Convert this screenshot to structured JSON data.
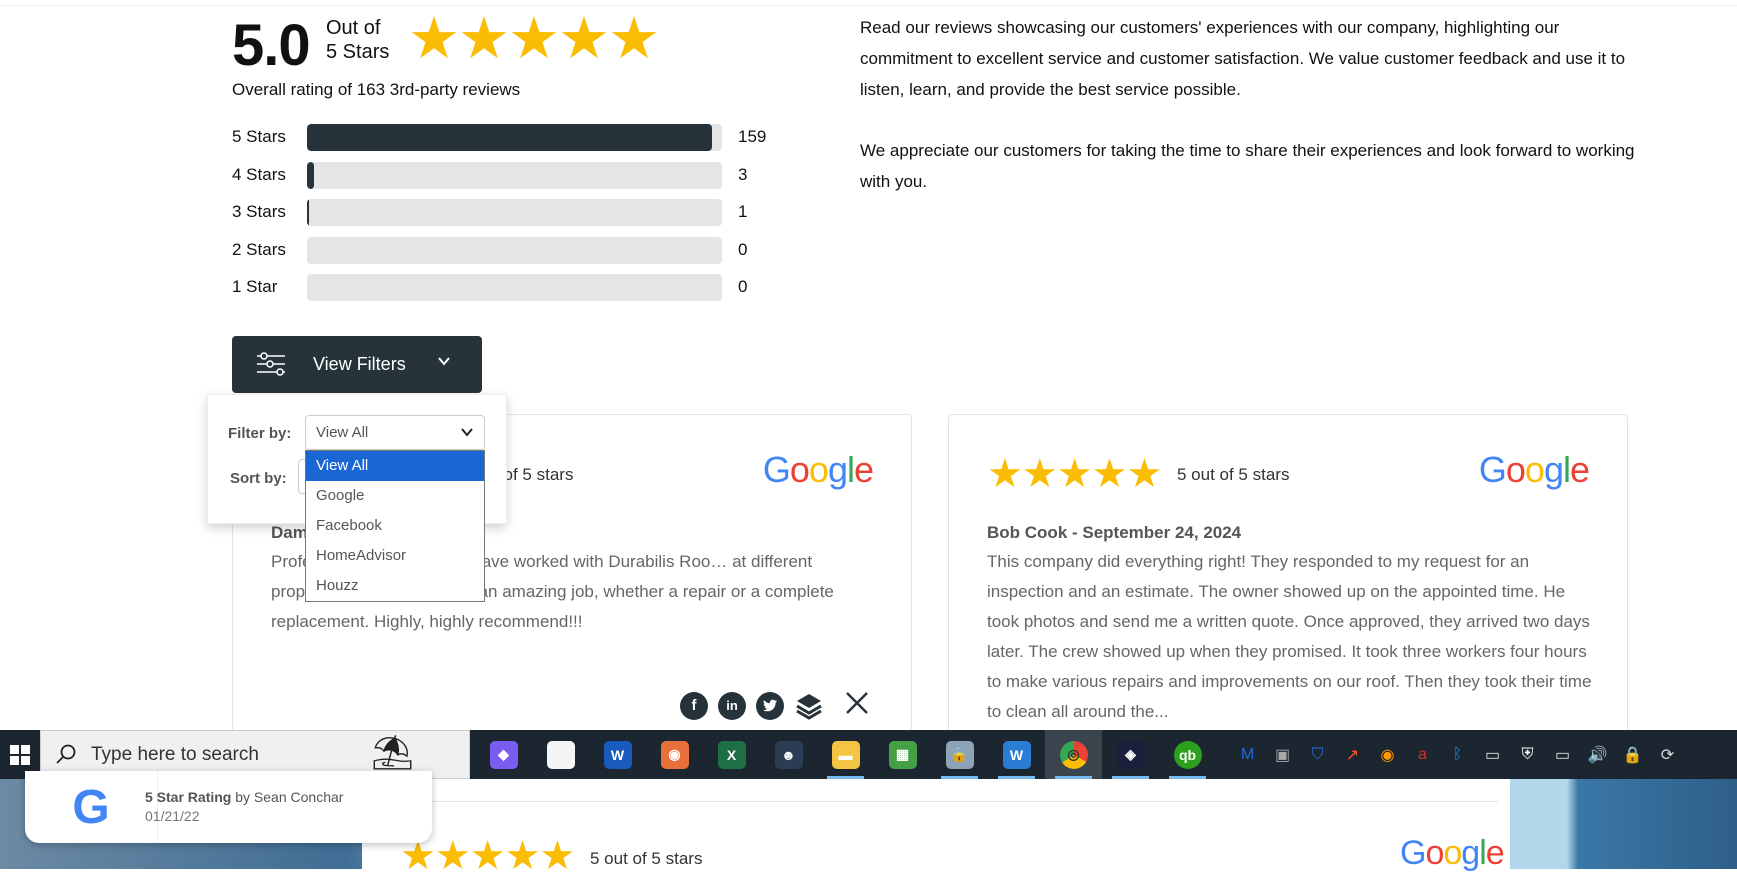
{
  "summary": {
    "score": "5.0",
    "out_of_line1": "Out of",
    "out_of_line2": "5 Stars",
    "stars": "★★★★★",
    "overall": "Overall rating of 163 3rd-party reviews"
  },
  "breakdown": [
    {
      "label": "5 Stars",
      "count": "159",
      "fraction": 0.975
    },
    {
      "label": "4 Stars",
      "count": "3",
      "fraction": 0.018
    },
    {
      "label": "3 Stars",
      "count": "1",
      "fraction": 0.006
    },
    {
      "label": "2 Stars",
      "count": "0",
      "fraction": 0
    },
    {
      "label": "1 Star",
      "count": "0",
      "fraction": 0
    }
  ],
  "intro": {
    "p1": "Read our reviews showcasing our customers' experiences with our company, highlighting our commitment to excellent service and customer satisfaction. We value customer feedback and use it to listen, learn, and provide the best service possible.",
    "p2": "We appreciate our customers for taking the time to share their experiences and look forward to working with you."
  },
  "filters": {
    "button_label": "View Filters",
    "filter_label": "Filter by:",
    "sort_label": "Sort by:",
    "filter_value": "View All",
    "options": [
      "View All",
      "Google",
      "Facebook",
      "HomeAdvisor",
      "Houzz"
    ],
    "selected_index": 0
  },
  "reviews": [
    {
      "stars": "★★★★★",
      "rating_text": "5 out of 5 stars",
      "source": "Google",
      "author": "Dam… - …20, 2025",
      "text": "Profe… and fairly priced. I have worked with Durabilis Roo… at different properties. They always do an amazing job, whether a repair or a complete replacement. Highly, highly recommend!!!"
    },
    {
      "stars": "★★★★★",
      "rating_text": "5 out of 5 stars",
      "source": "Google",
      "author": "Bob Cook - September 24, 2024",
      "text": "This company did everything right! They responded to my request for an inspection and an estimate. The owner showed up on the appointed time. He took photos and send me a written quote. Once approved, they arrived two days later. The crew showed up when they promised. It took three workers four hours to make various repairs and improvements on our roof. Then they took their time to clean all around the..."
    }
  ],
  "share_icons": [
    "facebook-icon",
    "linkedin-icon",
    "twitter-icon",
    "layers-icon",
    "close-icon"
  ],
  "taskbar": {
    "search_placeholder": "Type here to search",
    "apps": [
      "Copilot",
      "LibreOffice",
      "Word",
      "Screenshot",
      "Excel",
      "Malware app",
      "File Explorer",
      "LibreOffice Calc",
      "VPN Lock",
      "Word Alt",
      "Chrome",
      "Photo Editor",
      "QuickBooks"
    ],
    "tray": [
      "Malwarebytes",
      "Remote Desktop",
      "Guard",
      "Charts",
      "Camera",
      "Avira",
      "Bluetooth",
      "Battery",
      "Security",
      "Network",
      "Volume",
      "Lock",
      "Sync"
    ]
  },
  "toast": {
    "title_bold": "5 Star Rating",
    "title_rest": " by Sean Conchar",
    "date": "01/21/22"
  },
  "next_review": {
    "stars": "★★★★★",
    "rating_text": "5 out of 5 stars",
    "source": "Google"
  }
}
